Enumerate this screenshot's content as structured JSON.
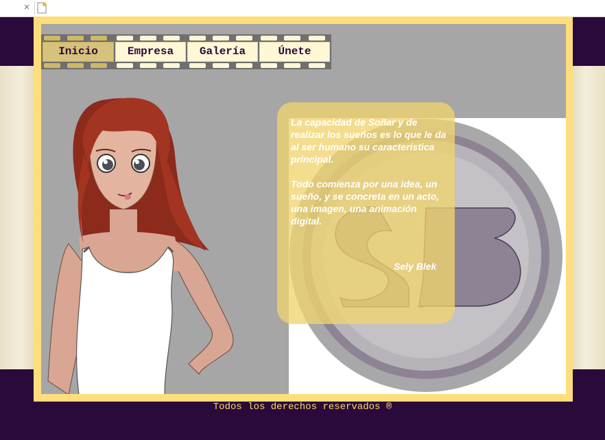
{
  "browser": {
    "close_glyph": "×",
    "new_tab_icon": "new-tab-icon"
  },
  "nav": {
    "items": [
      {
        "label": "Inicio",
        "active": true
      },
      {
        "label": "Empresa",
        "active": false
      },
      {
        "label": "Galería",
        "active": false
      },
      {
        "label": "Únete",
        "active": false
      }
    ]
  },
  "quote": {
    "paragraph1": "La capacidad de Soñar y de realizar los sueños es lo que le da al ser humano su característica principal.",
    "paragraph2": "Todo comienza por una idea, un sueño, y se concreta en un acto, una imagen, una animación digital.",
    "signature": "Sely Blek"
  },
  "footer": {
    "text": "Todos los derechos reservados ®"
  },
  "colors": {
    "background": "#2a0a3a",
    "frame": "#fede7c",
    "stage": "#a6a6a6",
    "nav_active": "#d7c27b",
    "nav_item": "#fff8d6",
    "footer_text": "#ffd86a"
  }
}
